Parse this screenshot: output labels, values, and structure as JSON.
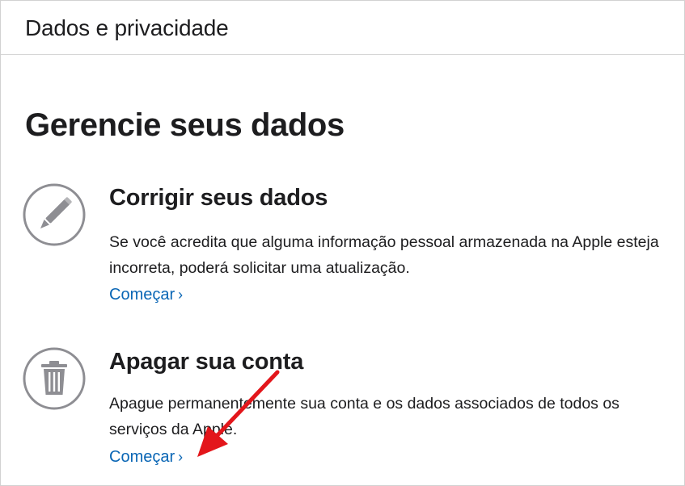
{
  "header": {
    "title": "Dados e privacidade"
  },
  "main": {
    "title": "Gerencie seus dados",
    "sections": [
      {
        "title": "Corrigir seus dados",
        "description": "Se você acredita que alguma informação pessoal armazenada na Apple esteja incorreta, poderá solicitar uma atualização.",
        "link_label": "Começar",
        "link_chevron": "›",
        "icon": "pencil-icon"
      },
      {
        "title": "Apagar sua conta",
        "description": "Apague permanentemente sua conta e os dados associados de todos os serviços da Apple.",
        "link_label": "Começar",
        "link_chevron": "›",
        "icon": "trash-icon"
      }
    ]
  },
  "colors": {
    "link": "#0a66b5",
    "icon_stroke": "#8e8e93",
    "annotation_arrow": "#e3161b"
  }
}
